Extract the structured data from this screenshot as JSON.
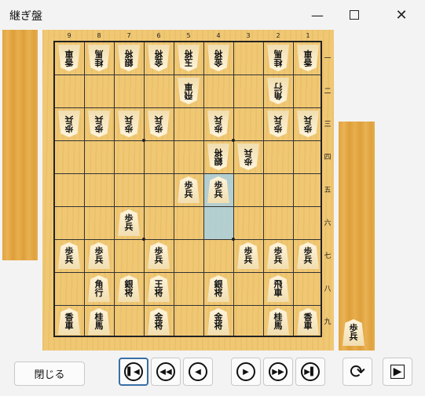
{
  "window": {
    "title": "継ぎ盤",
    "minimize_icon": "minimize-icon",
    "maximize_icon": "maximize-icon",
    "close_icon": "close-icon"
  },
  "board": {
    "file_labels": [
      "9",
      "8",
      "7",
      "6",
      "5",
      "4",
      "3",
      "2",
      "1"
    ],
    "rank_labels": [
      "一",
      "二",
      "三",
      "四",
      "五",
      "六",
      "七",
      "八",
      "九"
    ],
    "highlight_squares": [
      [
        4,
        5
      ],
      [
        4,
        6
      ]
    ],
    "pieces": [
      {
        "file": 9,
        "rank": 1,
        "side": "gote",
        "t": [
          "香",
          "車"
        ]
      },
      {
        "file": 8,
        "rank": 1,
        "side": "gote",
        "t": [
          "桂",
          "馬"
        ]
      },
      {
        "file": 7,
        "rank": 1,
        "side": "gote",
        "t": [
          "銀",
          "将"
        ]
      },
      {
        "file": 6,
        "rank": 1,
        "side": "gote",
        "t": [
          "金",
          "将"
        ]
      },
      {
        "file": 5,
        "rank": 1,
        "side": "gote",
        "t": [
          "玉",
          "将"
        ]
      },
      {
        "file": 4,
        "rank": 1,
        "side": "gote",
        "t": [
          "金",
          "将"
        ]
      },
      {
        "file": 2,
        "rank": 1,
        "side": "gote",
        "t": [
          "桂",
          "馬"
        ]
      },
      {
        "file": 1,
        "rank": 1,
        "side": "gote",
        "t": [
          "香",
          "車"
        ]
      },
      {
        "file": 5,
        "rank": 2,
        "side": "gote",
        "t": [
          "飛",
          "車"
        ]
      },
      {
        "file": 2,
        "rank": 2,
        "side": "gote",
        "t": [
          "角",
          "行"
        ]
      },
      {
        "file": 9,
        "rank": 3,
        "side": "gote",
        "t": [
          "歩",
          "兵"
        ]
      },
      {
        "file": 8,
        "rank": 3,
        "side": "gote",
        "t": [
          "歩",
          "兵"
        ]
      },
      {
        "file": 7,
        "rank": 3,
        "side": "gote",
        "t": [
          "歩",
          "兵"
        ]
      },
      {
        "file": 6,
        "rank": 3,
        "side": "gote",
        "t": [
          "歩",
          "兵"
        ]
      },
      {
        "file": 4,
        "rank": 3,
        "side": "gote",
        "t": [
          "歩",
          "兵"
        ]
      },
      {
        "file": 2,
        "rank": 3,
        "side": "gote",
        "t": [
          "歩",
          "兵"
        ]
      },
      {
        "file": 1,
        "rank": 3,
        "side": "gote",
        "t": [
          "歩",
          "兵"
        ]
      },
      {
        "file": 4,
        "rank": 4,
        "side": "gote",
        "t": [
          "銀",
          "将"
        ]
      },
      {
        "file": 3,
        "rank": 4,
        "side": "gote",
        "t": [
          "歩",
          "兵"
        ]
      },
      {
        "file": 5,
        "rank": 5,
        "side": "sente",
        "t": [
          "歩",
          "兵"
        ]
      },
      {
        "file": 4,
        "rank": 5,
        "side": "sente",
        "t": [
          "歩",
          "兵"
        ]
      },
      {
        "file": 7,
        "rank": 6,
        "side": "sente",
        "t": [
          "歩",
          "兵"
        ]
      },
      {
        "file": 9,
        "rank": 7,
        "side": "sente",
        "t": [
          "歩",
          "兵"
        ]
      },
      {
        "file": 8,
        "rank": 7,
        "side": "sente",
        "t": [
          "歩",
          "兵"
        ]
      },
      {
        "file": 6,
        "rank": 7,
        "side": "sente",
        "t": [
          "歩",
          "兵"
        ]
      },
      {
        "file": 3,
        "rank": 7,
        "side": "sente",
        "t": [
          "歩",
          "兵"
        ]
      },
      {
        "file": 2,
        "rank": 7,
        "side": "sente",
        "t": [
          "歩",
          "兵"
        ]
      },
      {
        "file": 1,
        "rank": 7,
        "side": "sente",
        "t": [
          "歩",
          "兵"
        ]
      },
      {
        "file": 8,
        "rank": 8,
        "side": "sente",
        "t": [
          "角",
          "行"
        ]
      },
      {
        "file": 7,
        "rank": 8,
        "side": "sente",
        "t": [
          "銀",
          "将"
        ]
      },
      {
        "file": 6,
        "rank": 8,
        "side": "sente",
        "t": [
          "王",
          "将"
        ]
      },
      {
        "file": 4,
        "rank": 8,
        "side": "sente",
        "t": [
          "銀",
          "将"
        ]
      },
      {
        "file": 2,
        "rank": 8,
        "side": "sente",
        "t": [
          "飛",
          "車"
        ]
      },
      {
        "file": 9,
        "rank": 9,
        "side": "sente",
        "t": [
          "香",
          "車"
        ]
      },
      {
        "file": 8,
        "rank": 9,
        "side": "sente",
        "t": [
          "桂",
          "馬"
        ]
      },
      {
        "file": 6,
        "rank": 9,
        "side": "sente",
        "t": [
          "金",
          "将"
        ]
      },
      {
        "file": 4,
        "rank": 9,
        "side": "sente",
        "t": [
          "金",
          "将"
        ]
      },
      {
        "file": 2,
        "rank": 9,
        "side": "sente",
        "t": [
          "桂",
          "馬"
        ]
      },
      {
        "file": 1,
        "rank": 9,
        "side": "sente",
        "t": [
          "香",
          "車"
        ]
      }
    ]
  },
  "hand_sente": [
    {
      "t": [
        "歩",
        "兵"
      ]
    }
  ],
  "hand_gote": [],
  "buttons": {
    "close_label": "閉じる",
    "first_icon": "skip-to-start-icon",
    "back_fast_icon": "fast-backward-icon",
    "back_icon": "step-backward-icon",
    "forward_icon": "step-forward-icon",
    "forward_fast_icon": "fast-forward-icon",
    "last_icon": "skip-to-end-icon",
    "flip_icon": "rotate-board-icon",
    "play_icon": "play-icon"
  }
}
